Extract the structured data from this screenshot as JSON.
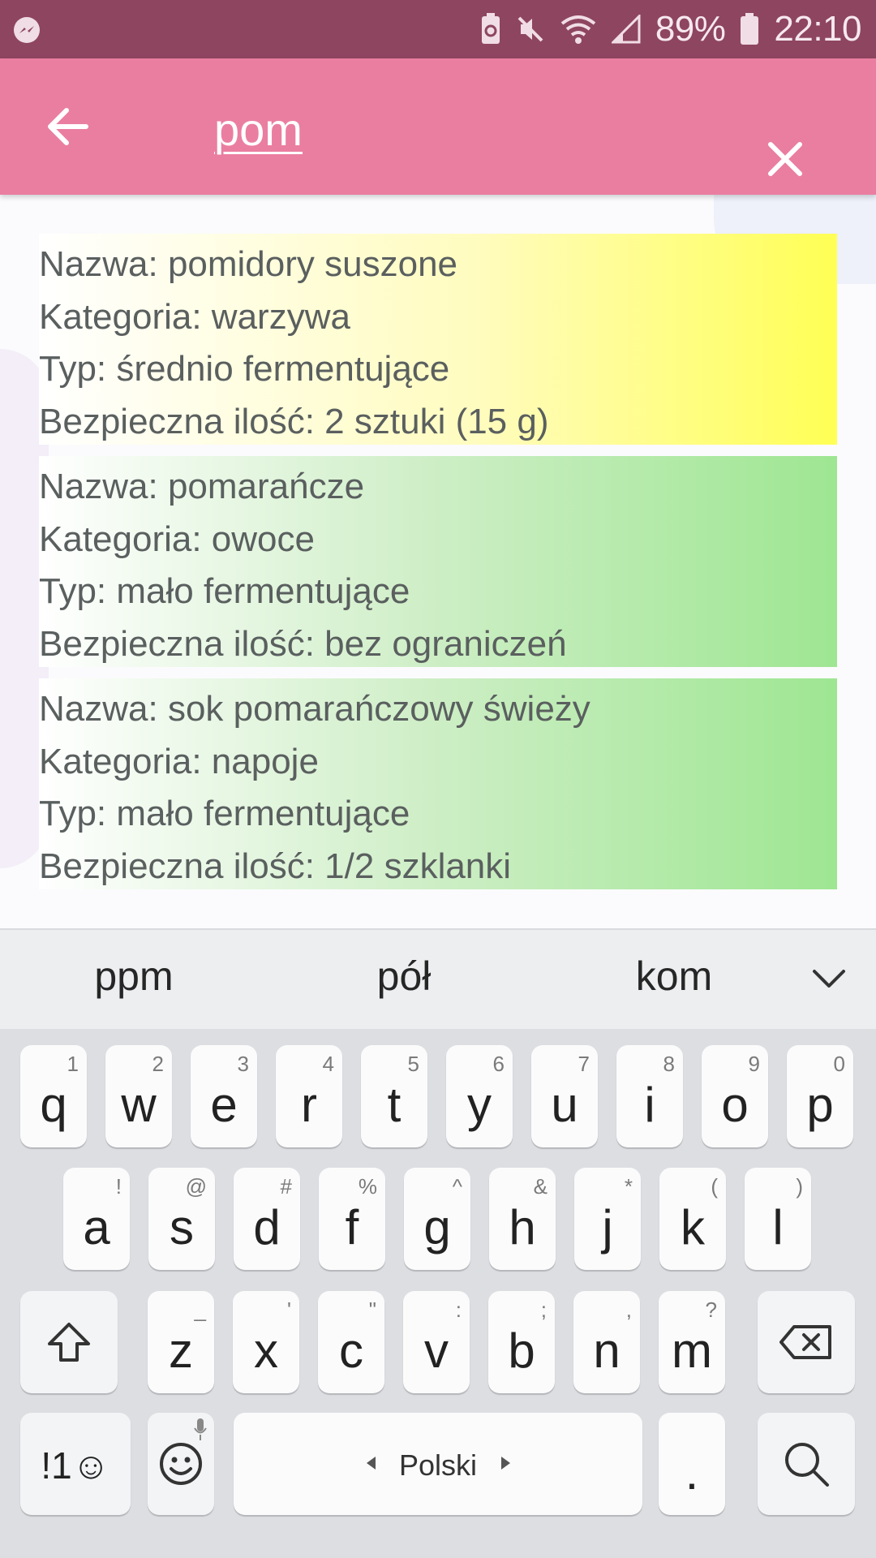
{
  "status_bar": {
    "battery_percent": "89%",
    "time": "22:10",
    "icons": [
      "messenger-icon",
      "battery-saver-icon",
      "mute-icon",
      "wifi-icon",
      "signal-icon",
      "battery-icon"
    ]
  },
  "app_bar": {
    "query": "pom",
    "back_icon": "arrow-left-icon",
    "clear_icon": "close-icon",
    "color": "#ea7ea1"
  },
  "results": [
    {
      "name": "Nazwa: pomidory suszone",
      "category": "Kategoria: warzywa",
      "type": "Typ: średnio fermentujące",
      "safe_amount": "Bezpieczna ilość: 2 sztuki (15 g)",
      "color": "#ffff55"
    },
    {
      "name": "Nazwa: pomarańcze",
      "category": "Kategoria: owoce",
      "type": "Typ: mało fermentujące",
      "safe_amount": "Bezpieczna ilość: bez ograniczeń",
      "color": "#9ee692"
    },
    {
      "name": "Nazwa: sok pomarańczowy świeży",
      "category": "Kategoria: napoje",
      "type": "Typ: mało fermentujące",
      "safe_amount": "Bezpieczna ilość: 1/2 szklanki",
      "color": "#9ee692"
    }
  ],
  "keyboard": {
    "suggestions": [
      "ppm",
      "pół",
      "kom"
    ],
    "row1": [
      {
        "ch": "q",
        "sub": "1"
      },
      {
        "ch": "w",
        "sub": "2"
      },
      {
        "ch": "e",
        "sub": "3"
      },
      {
        "ch": "r",
        "sub": "4"
      },
      {
        "ch": "t",
        "sub": "5"
      },
      {
        "ch": "y",
        "sub": "6"
      },
      {
        "ch": "u",
        "sub": "7"
      },
      {
        "ch": "i",
        "sub": "8"
      },
      {
        "ch": "o",
        "sub": "9"
      },
      {
        "ch": "p",
        "sub": "0"
      }
    ],
    "row2": [
      {
        "ch": "a",
        "sub": "!"
      },
      {
        "ch": "s",
        "sub": "@"
      },
      {
        "ch": "d",
        "sub": "#"
      },
      {
        "ch": "f",
        "sub": "%"
      },
      {
        "ch": "g",
        "sub": "^"
      },
      {
        "ch": "h",
        "sub": "&"
      },
      {
        "ch": "j",
        "sub": "*"
      },
      {
        "ch": "k",
        "sub": "("
      },
      {
        "ch": "l",
        "sub": ")"
      }
    ],
    "row3": [
      {
        "ch": "z",
        "sub": "_"
      },
      {
        "ch": "x",
        "sub": "'"
      },
      {
        "ch": "c",
        "sub": "\""
      },
      {
        "ch": "v",
        "sub": ":"
      },
      {
        "ch": "b",
        "sub": ";"
      },
      {
        "ch": "n",
        "sub": ","
      },
      {
        "ch": "m",
        "sub": "?"
      }
    ],
    "symbols_label": "!1☺",
    "space_label": "Polski",
    "period_label": ".",
    "icons": [
      "shift-icon",
      "backspace-icon",
      "emoji-icon",
      "mic-icon",
      "search-icon",
      "chevron-down-icon"
    ]
  }
}
